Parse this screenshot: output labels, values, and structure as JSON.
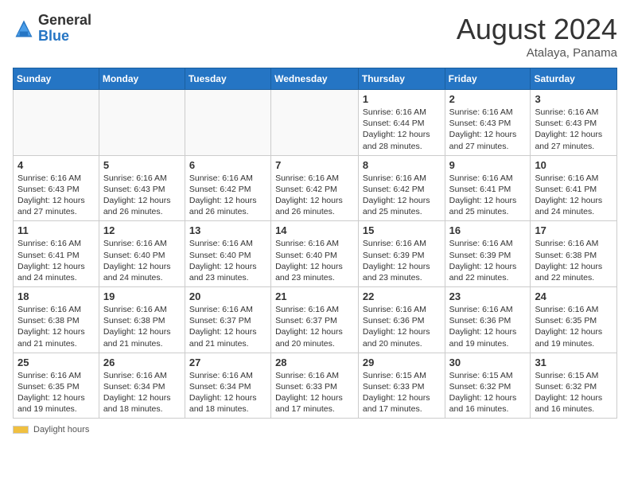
{
  "logo": {
    "general": "General",
    "blue": "Blue"
  },
  "title": "August 2024",
  "location": "Atalaya, Panama",
  "days_of_week": [
    "Sunday",
    "Monday",
    "Tuesday",
    "Wednesday",
    "Thursday",
    "Friday",
    "Saturday"
  ],
  "footer": {
    "label": "Daylight hours"
  },
  "weeks": [
    [
      {
        "day": "",
        "info": ""
      },
      {
        "day": "",
        "info": ""
      },
      {
        "day": "",
        "info": ""
      },
      {
        "day": "",
        "info": ""
      },
      {
        "day": "1",
        "info": "Sunrise: 6:16 AM\nSunset: 6:44 PM\nDaylight: 12 hours and 28 minutes."
      },
      {
        "day": "2",
        "info": "Sunrise: 6:16 AM\nSunset: 6:43 PM\nDaylight: 12 hours and 27 minutes."
      },
      {
        "day": "3",
        "info": "Sunrise: 6:16 AM\nSunset: 6:43 PM\nDaylight: 12 hours and 27 minutes."
      }
    ],
    [
      {
        "day": "4",
        "info": "Sunrise: 6:16 AM\nSunset: 6:43 PM\nDaylight: 12 hours and 27 minutes."
      },
      {
        "day": "5",
        "info": "Sunrise: 6:16 AM\nSunset: 6:43 PM\nDaylight: 12 hours and 26 minutes."
      },
      {
        "day": "6",
        "info": "Sunrise: 6:16 AM\nSunset: 6:42 PM\nDaylight: 12 hours and 26 minutes."
      },
      {
        "day": "7",
        "info": "Sunrise: 6:16 AM\nSunset: 6:42 PM\nDaylight: 12 hours and 26 minutes."
      },
      {
        "day": "8",
        "info": "Sunrise: 6:16 AM\nSunset: 6:42 PM\nDaylight: 12 hours and 25 minutes."
      },
      {
        "day": "9",
        "info": "Sunrise: 6:16 AM\nSunset: 6:41 PM\nDaylight: 12 hours and 25 minutes."
      },
      {
        "day": "10",
        "info": "Sunrise: 6:16 AM\nSunset: 6:41 PM\nDaylight: 12 hours and 24 minutes."
      }
    ],
    [
      {
        "day": "11",
        "info": "Sunrise: 6:16 AM\nSunset: 6:41 PM\nDaylight: 12 hours and 24 minutes."
      },
      {
        "day": "12",
        "info": "Sunrise: 6:16 AM\nSunset: 6:40 PM\nDaylight: 12 hours and 24 minutes."
      },
      {
        "day": "13",
        "info": "Sunrise: 6:16 AM\nSunset: 6:40 PM\nDaylight: 12 hours and 23 minutes."
      },
      {
        "day": "14",
        "info": "Sunrise: 6:16 AM\nSunset: 6:40 PM\nDaylight: 12 hours and 23 minutes."
      },
      {
        "day": "15",
        "info": "Sunrise: 6:16 AM\nSunset: 6:39 PM\nDaylight: 12 hours and 23 minutes."
      },
      {
        "day": "16",
        "info": "Sunrise: 6:16 AM\nSunset: 6:39 PM\nDaylight: 12 hours and 22 minutes."
      },
      {
        "day": "17",
        "info": "Sunrise: 6:16 AM\nSunset: 6:38 PM\nDaylight: 12 hours and 22 minutes."
      }
    ],
    [
      {
        "day": "18",
        "info": "Sunrise: 6:16 AM\nSunset: 6:38 PM\nDaylight: 12 hours and 21 minutes."
      },
      {
        "day": "19",
        "info": "Sunrise: 6:16 AM\nSunset: 6:38 PM\nDaylight: 12 hours and 21 minutes."
      },
      {
        "day": "20",
        "info": "Sunrise: 6:16 AM\nSunset: 6:37 PM\nDaylight: 12 hours and 21 minutes."
      },
      {
        "day": "21",
        "info": "Sunrise: 6:16 AM\nSunset: 6:37 PM\nDaylight: 12 hours and 20 minutes."
      },
      {
        "day": "22",
        "info": "Sunrise: 6:16 AM\nSunset: 6:36 PM\nDaylight: 12 hours and 20 minutes."
      },
      {
        "day": "23",
        "info": "Sunrise: 6:16 AM\nSunset: 6:36 PM\nDaylight: 12 hours and 19 minutes."
      },
      {
        "day": "24",
        "info": "Sunrise: 6:16 AM\nSunset: 6:35 PM\nDaylight: 12 hours and 19 minutes."
      }
    ],
    [
      {
        "day": "25",
        "info": "Sunrise: 6:16 AM\nSunset: 6:35 PM\nDaylight: 12 hours and 19 minutes."
      },
      {
        "day": "26",
        "info": "Sunrise: 6:16 AM\nSunset: 6:34 PM\nDaylight: 12 hours and 18 minutes."
      },
      {
        "day": "27",
        "info": "Sunrise: 6:16 AM\nSunset: 6:34 PM\nDaylight: 12 hours and 18 minutes."
      },
      {
        "day": "28",
        "info": "Sunrise: 6:16 AM\nSunset: 6:33 PM\nDaylight: 12 hours and 17 minutes."
      },
      {
        "day": "29",
        "info": "Sunrise: 6:15 AM\nSunset: 6:33 PM\nDaylight: 12 hours and 17 minutes."
      },
      {
        "day": "30",
        "info": "Sunrise: 6:15 AM\nSunset: 6:32 PM\nDaylight: 12 hours and 16 minutes."
      },
      {
        "day": "31",
        "info": "Sunrise: 6:15 AM\nSunset: 6:32 PM\nDaylight: 12 hours and 16 minutes."
      }
    ]
  ]
}
